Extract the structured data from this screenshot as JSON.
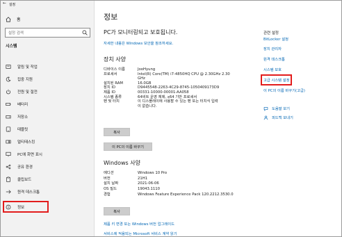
{
  "window": {
    "title": "설정"
  },
  "sidebar": {
    "home_label": "홈",
    "search_placeholder": "설정 검색",
    "section_title": "시스템",
    "items": [
      {
        "label": "알림 및 작업",
        "icon": "notification-icon"
      },
      {
        "label": "집중 지원",
        "icon": "focus-assist-icon"
      },
      {
        "label": "전원 및 절전",
        "icon": "power-icon"
      },
      {
        "label": "배터리",
        "icon": "battery-icon"
      },
      {
        "label": "저장소",
        "icon": "storage-icon"
      },
      {
        "label": "태블릿",
        "icon": "tablet-icon"
      },
      {
        "label": "멀티태스킹",
        "icon": "multitasking-icon"
      },
      {
        "label": "PC에 화면 표시",
        "icon": "projecting-icon"
      },
      {
        "label": "공유 환경",
        "icon": "shared-experiences-icon"
      },
      {
        "label": "클립보드",
        "icon": "clipboard-icon"
      },
      {
        "label": "원격 데스크톱",
        "icon": "remote-desktop-icon"
      },
      {
        "label": "정보",
        "icon": "info-icon",
        "selected": true
      }
    ]
  },
  "main": {
    "title": "정보",
    "protection_title": "PC가 모니터링되고 보호됩니다.",
    "protection_link": "자세한 내용은 Windows 보안을 참조하세요.",
    "device_specs": {
      "title": "장치 사양",
      "rows": [
        {
          "key": "디바이스 이름",
          "value": "JooHyung"
        },
        {
          "key": "프로세서",
          "value": "Intel(R) Core(TM) i7-4850HQ CPU @ 2.30GHz   2.30"
        },
        {
          "key": "",
          "value": "GHz"
        },
        {
          "key": "설치된 RAM",
          "value": "16.0GB"
        },
        {
          "key": "장치 ID",
          "value": "D9445548-2263-4C29-8745-1050409173D9"
        },
        {
          "key": "제품 ID",
          "value": "00331-10000-00001-AA058"
        },
        {
          "key": "시스템 종류",
          "value": "64비트 운영 체제, x64 기반 프로세서"
        },
        {
          "key": "펜 및 터치",
          "value": "이 디스플레이에 사용할 수 있는 펜 또는 터치식 입력"
        },
        {
          "key": "",
          "value": "이 없습니다."
        }
      ],
      "copy_button": "복사",
      "rename_button": "이 PC의 이름 바꾸기"
    },
    "windows_specs": {
      "title": "Windows 사양",
      "rows": [
        {
          "key": "에디션",
          "value": "Windows 10 Pro"
        },
        {
          "key": "버전",
          "value": "21H1"
        },
        {
          "key": "설치 날짜",
          "value": "2021-06-06"
        },
        {
          "key": "OS 빌드",
          "value": "19043.1110"
        },
        {
          "key": "경험",
          "value": "Windows Feature Experience Pack 120.2212.3530.0"
        }
      ],
      "copy_button": "복사"
    },
    "link_product_key": "제품 키 변경 또는 Windows 버전 업그레이드",
    "link_services": "서비스에 적용되는 Microsoft 서비스 계약 읽기"
  },
  "related": {
    "title": "관련 설정",
    "links": [
      "BitLocker 설정",
      "장치 관리자",
      "원격 데스크톱",
      "시스템 보호",
      "고급 시스템 설정",
      "이 PC의 이름 바꾸기(고급)"
    ],
    "help_label": "도움말 보기",
    "feedback_label": "피드백 보내기",
    "highlight_color": "#e21c1c",
    "link_color": "#0066b4"
  }
}
